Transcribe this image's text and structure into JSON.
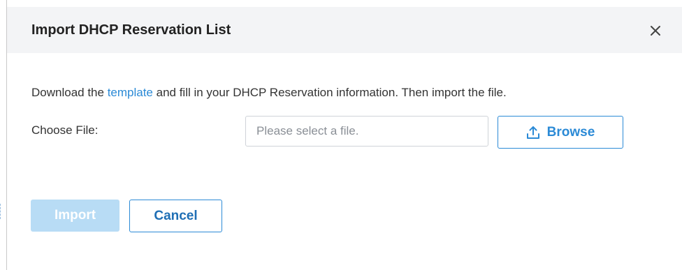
{
  "dialog": {
    "title": "Import DHCP Reservation List",
    "close_icon": "close-icon"
  },
  "instruction": {
    "prefix": "Download the ",
    "link_text": "template",
    "suffix": " and fill in your DHCP Reservation information. Then import the file."
  },
  "file_field": {
    "label": "Choose File:",
    "value": "",
    "placeholder": "Please select a file."
  },
  "browse_button": {
    "icon": "upload-icon",
    "label": "Browse"
  },
  "actions": {
    "import_label": "Import",
    "import_enabled": false,
    "cancel_label": "Cancel"
  },
  "colors": {
    "accent": "#2b8ad6",
    "header_bg": "#f3f4f6",
    "disabled_button": "#b8dcf5"
  }
}
